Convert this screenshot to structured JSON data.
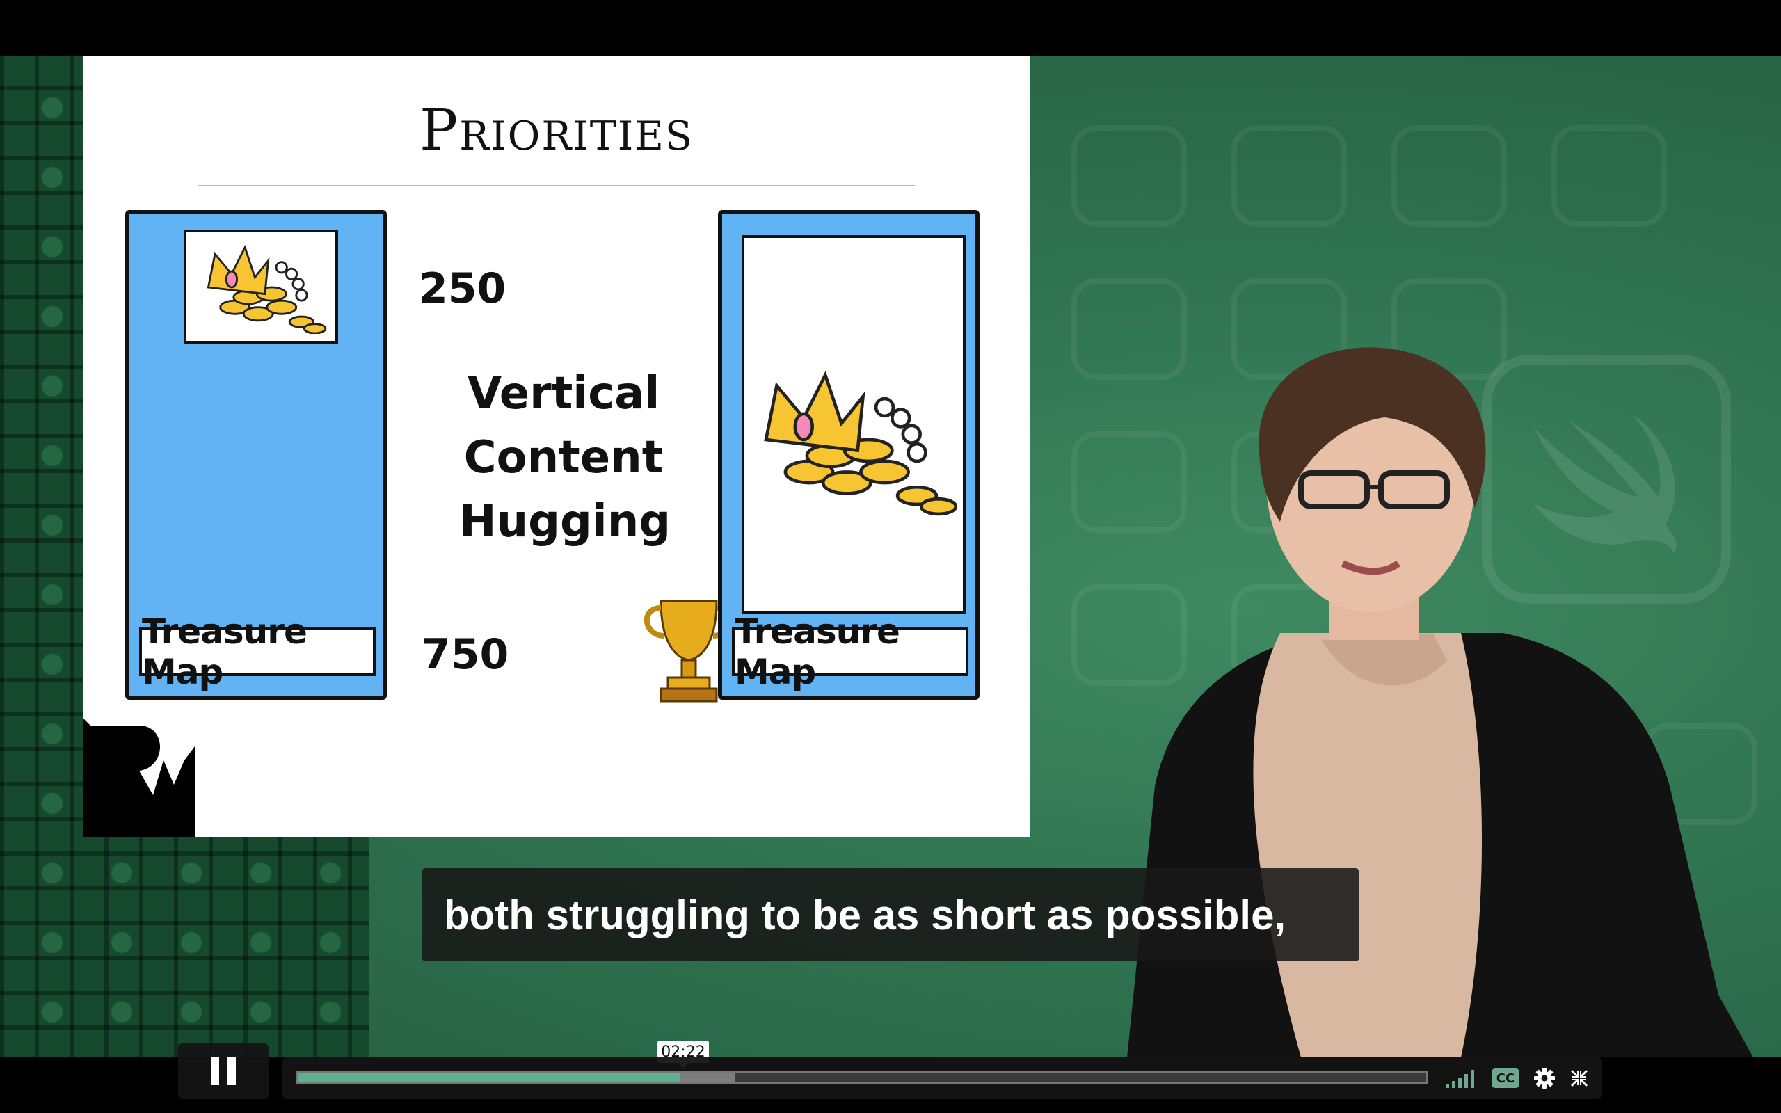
{
  "slide": {
    "title": "Priorities",
    "left_value": "250",
    "right_value": "750",
    "center_lines": [
      "Vertical",
      "Content",
      "Hugging"
    ],
    "left_label": "Treasure Map",
    "right_label": "Treasure Map"
  },
  "caption": {
    "text": "both struggling to be as short as possible,"
  },
  "player": {
    "current_time": "02:22",
    "progress_played": 0.339,
    "progress_buffered": 0.387,
    "icons": [
      "pause-icon",
      "volume-bars-icon",
      "closed-captions-icon",
      "settings-gear-icon",
      "exit-fullscreen-icon"
    ],
    "cc_label": "CC",
    "accent_color": "#5fb18d"
  }
}
